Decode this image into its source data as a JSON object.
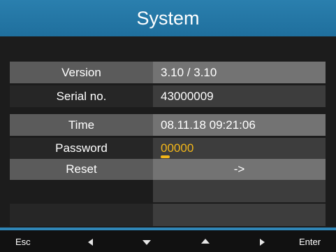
{
  "title": "System",
  "rows": [
    {
      "label": "Version",
      "value": "3.10 / 3.10"
    },
    {
      "label": "Serial no.",
      "value": "43000009"
    },
    {
      "label": "Time",
      "value": "08.11.18  09:21:06"
    },
    {
      "label": "Password",
      "value": "00000"
    },
    {
      "label": "Reset",
      "value": "->"
    }
  ],
  "footer": {
    "esc": "Esc",
    "enter": "Enter",
    "left_icon": "arrow-left-icon",
    "down_icon": "arrow-down-icon",
    "up_icon": "arrow-up-icon",
    "right_icon": "arrow-right-icon"
  },
  "colors": {
    "title_bar": "#2a7fae",
    "password_highlight": "#f2b619"
  }
}
